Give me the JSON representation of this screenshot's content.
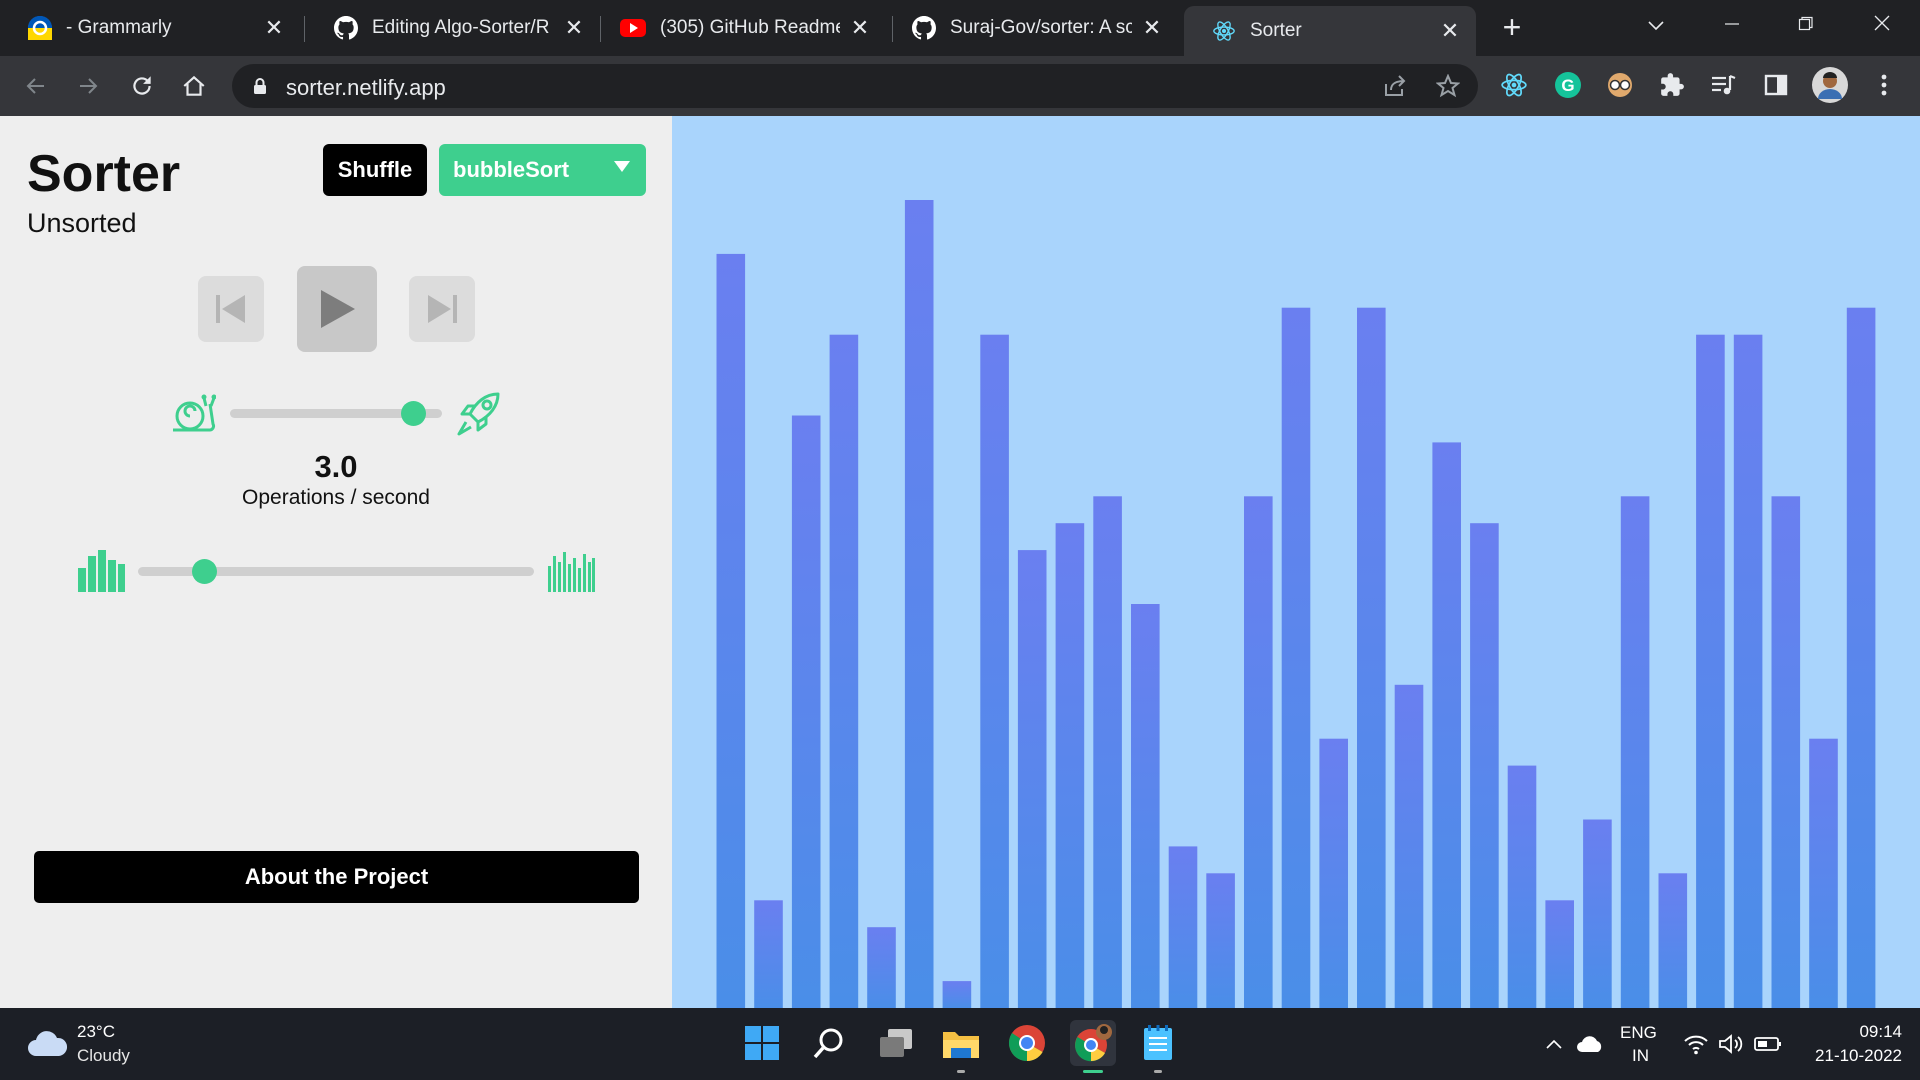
{
  "browser": {
    "tabs": [
      {
        "title": "- Grammarly",
        "icon": "grammarly-g-icon",
        "active": false
      },
      {
        "title": "Editing Algo-Sorter/R",
        "icon": "github-icon",
        "active": false
      },
      {
        "title": "(305) GitHub Readme",
        "icon": "youtube-icon",
        "active": false
      },
      {
        "title": "Suraj-Gov/sorter: A sc",
        "icon": "github-icon",
        "active": false
      },
      {
        "title": "Sorter",
        "icon": "react-icon",
        "active": true
      }
    ],
    "url": "sorter.netlify.app"
  },
  "app": {
    "title": "Sorter",
    "status": "Unsorted",
    "shuffle_label": "Shuffle",
    "algorithm_selected": "bubbleSort",
    "speed": {
      "value_text": "3.0",
      "unit": "Operations / second",
      "level": 0.88
    },
    "array_size": {
      "level": 0.17
    },
    "about_label": "About the Project",
    "accent_color": "#3ecf8e",
    "bar_color": "#5b7eec",
    "viz_background": "#a9d4fc"
  },
  "array": {
    "scale_max": 30,
    "values": [
      28,
      4,
      22,
      25,
      3,
      30,
      1,
      25,
      17,
      18,
      19,
      15,
      6,
      5,
      19,
      26,
      10,
      26,
      12,
      21,
      18,
      9,
      4,
      7,
      19,
      5,
      25,
      25,
      19,
      10,
      26
    ]
  },
  "taskbar": {
    "weather_temp": "23°C",
    "weather_cond": "Cloudy",
    "lang_line1": "ENG",
    "lang_line2": "IN",
    "time": "09:14",
    "date": "21-10-2022"
  }
}
